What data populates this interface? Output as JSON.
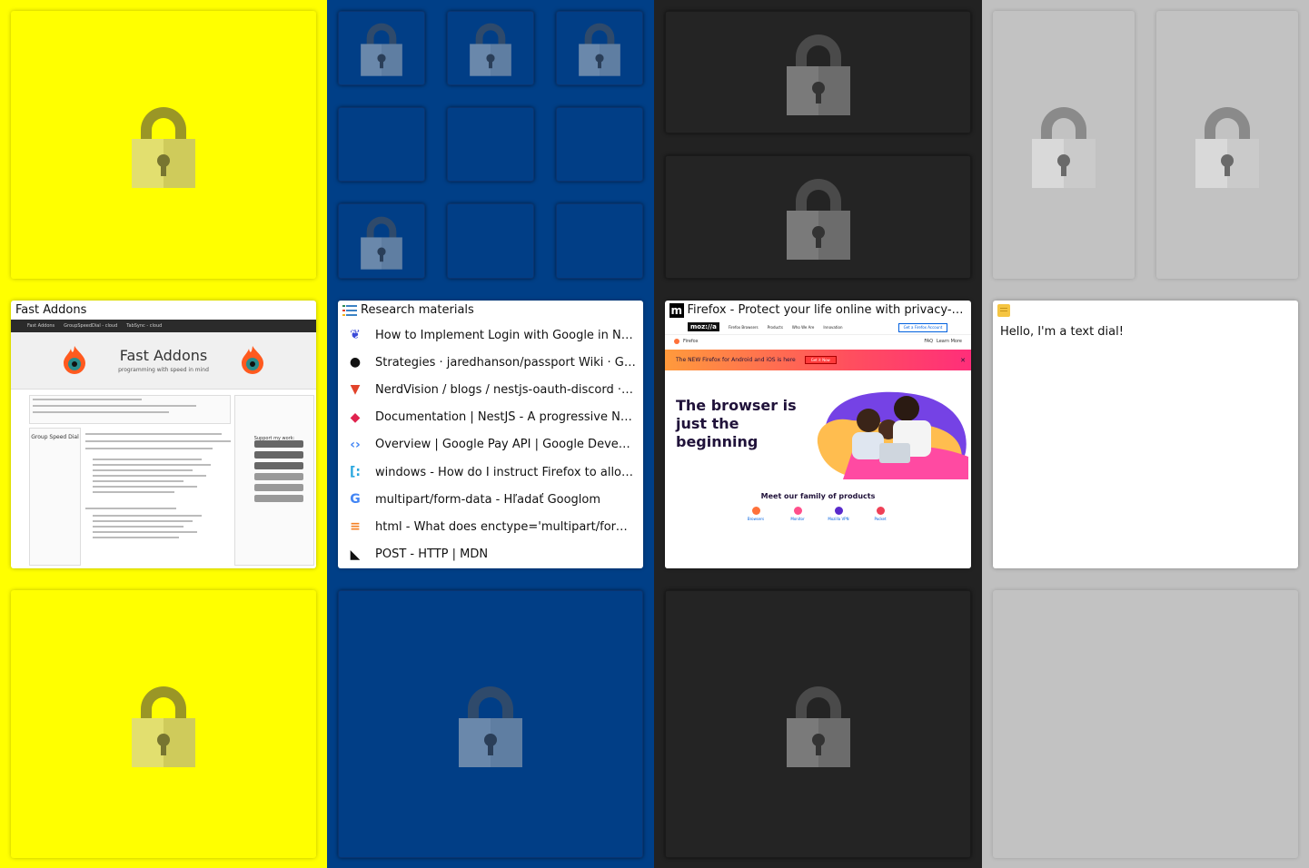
{
  "colors": {
    "yellow_group": "#ffff00",
    "blue_group": "#003f87",
    "dark_group": "#222222",
    "gray_group": "#c0c0c0"
  },
  "icons": {
    "locked_tile": "padlock-icon"
  },
  "fast_addons": {
    "title": "Fast Addons",
    "preview_nav": [
      "Fast Addons",
      "GroupSpeedDial - cloud",
      "TabSync - cloud"
    ],
    "preview_heading": "Fast Addons",
    "preview_subheading": "programming with speed in mind",
    "preview_sidebar_title": "Group Speed Dial",
    "preview_support_title": "Support my work:",
    "preview_buttons": [
      "Buy me a coffee",
      "Be my patron",
      "PayPal.Me",
      "patreon",
      "Bank Transfer",
      "Bitcoin"
    ]
  },
  "research": {
    "title": "Research materials",
    "items": [
      {
        "label": "How to Implement Login with Google in Nes…",
        "icon": "leaf-logo-icon",
        "color": "#3b4bd8",
        "glyph": "❦"
      },
      {
        "label": "Strategies · jaredhanson/passport Wiki · Git…",
        "icon": "github-icon",
        "color": "#111111",
        "glyph": "●"
      },
      {
        "label": "NerdVision / blogs / nestjs-oauth-discord · …",
        "icon": "gitlab-icon",
        "color": "#e2432a",
        "glyph": "▼"
      },
      {
        "label": "Documentation | NestJS - A progressive Nod…",
        "icon": "nestjs-icon",
        "color": "#e0234e",
        "glyph": "◆"
      },
      {
        "label": "Overview  |  Google Pay API  |  Google Deve…",
        "icon": "google-dev-icon",
        "color": "#4285f4",
        "glyph": "‹›"
      },
      {
        "label": "windows - How do I instruct Firefox to allow…",
        "icon": "superuser-icon",
        "color": "#2aa7de",
        "glyph": "[:"
      },
      {
        "label": "multipart/form-data - Hľadať Googlom",
        "icon": "google-icon",
        "color": "#4285f4",
        "glyph": "G"
      },
      {
        "label": "html - What does enctype='multipart/form-d…",
        "icon": "stackoverflow-icon",
        "color": "#f48024",
        "glyph": "≡"
      },
      {
        "label": "POST - HTTP | MDN",
        "icon": "mdn-icon",
        "color": "#111111",
        "glyph": "◣"
      }
    ]
  },
  "firefox": {
    "title": "Firefox - Protect your life online with privacy-fir…",
    "favicon": "m",
    "preview_nav": [
      "Firefox Browsers",
      "Products",
      "Who We Are",
      "Innovation"
    ],
    "preview_account": "Get a Firefox Account",
    "preview_brand": "Firefox",
    "preview_links": [
      "FAQ",
      "Learn More"
    ],
    "preview_banner": "The NEW Firefox for Android and iOS is here",
    "preview_banner_button": "Get it Now",
    "preview_heading": "The browser is just the beginning",
    "preview_family": "Meet our family of products",
    "preview_products": [
      "Browsers",
      "Monitor",
      "Mozilla VPN",
      "Pocket"
    ]
  },
  "text_dial": {
    "content": "Hello, I'm a text dial!"
  }
}
